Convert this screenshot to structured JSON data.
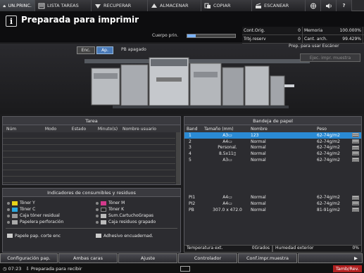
{
  "tabs": [
    {
      "label": "UN.PRINC.",
      "icon": "home-icon"
    },
    {
      "label": "LISTA TAREAS",
      "icon": "job-list-icon"
    },
    {
      "label": "RECUPERAR",
      "icon": "retrieve-icon"
    },
    {
      "label": "ALMACENAR",
      "icon": "store-icon"
    },
    {
      "label": "COPIAR",
      "icon": "copy-icon"
    },
    {
      "label": "ESCANEAR",
      "icon": "scan-icon"
    }
  ],
  "header": {
    "message": "Preparada para imprimir",
    "body_label": "Cuerpo prin.",
    "body_progress": 0.18
  },
  "counters": {
    "cont_orig_label": "Cont.Orig.",
    "cont_orig": "0",
    "memoria_label": "Memoria",
    "memoria": "100.000%",
    "trbj_label": "Trbj.reserv",
    "trbj": "0",
    "cant_label": "Cant. arch.",
    "cant": "99.429%"
  },
  "machine": {
    "enc": "Enc.",
    "ap": "Ap.",
    "pb": "PB apagado",
    "scan": "Prep. para usar Escáner",
    "eject": "Ejec. impr. muestra"
  },
  "tarea": {
    "title": "Tarea",
    "cols": [
      "Núm",
      "Modo",
      "Estado",
      "Minuto(s)",
      "Nombre usuario"
    ]
  },
  "consumibles": {
    "title": "Indicadores de consumibles y residuos",
    "rows": [
      [
        "Tóner Y",
        "Tóner M"
      ],
      [
        "Tóner C",
        "Tóner K"
      ],
      [
        "Caja tóner residual",
        "Sum.CartuchoGrapas"
      ],
      [
        "Papelera perforación",
        "Caja residuos grapado"
      ]
    ],
    "extra": [
      "Papele pap. corte enc",
      "Adhesivo encuadernad."
    ]
  },
  "bandeja": {
    "title": "Bandeja de papel",
    "cols": [
      "Band",
      "Tamaño (mm)",
      "Nombre",
      "Peso"
    ],
    "rows": [
      {
        "band": "1",
        "size": "A3▭",
        "name": "123",
        "peso": "62-74g/m2",
        "sel": true
      },
      {
        "band": "2",
        "size": "A4▭",
        "name": "Normal",
        "peso": "62-74g/m2"
      },
      {
        "band": "3",
        "size": "Personal.",
        "name": "Normal",
        "peso": "62-74g/m2"
      },
      {
        "band": "4",
        "size": "8.5x11▯",
        "name": "Normal",
        "peso": "62-74g/m2"
      },
      {
        "band": "5",
        "size": "A3▭",
        "name": "Normal",
        "peso": "62-74g/m2"
      }
    ],
    "rows2": [
      {
        "band": "PI1",
        "size": "A4▭",
        "name": "Normal",
        "peso": "62-74g/m2"
      },
      {
        "band": "PI2",
        "size": "A4▭",
        "name": "Normal",
        "peso": "62-74g/m2"
      },
      {
        "band": "PB",
        "size": "307.0 x 472.0",
        "name": "Normal",
        "peso": "81-91g/m2"
      }
    ],
    "temp_label": "Temperatura ext.",
    "temp": "0Grados",
    "hum_label": "Humedad exterior",
    "hum": "0%"
  },
  "bottom": [
    "Configuración pap.",
    "Ambas caras",
    "Ajuste",
    "Controlador",
    "Conf.impr.muestra"
  ],
  "status": {
    "time": "07:23",
    "msg": "Preparada para recibir",
    "tamb": "Tamb/Rev."
  }
}
